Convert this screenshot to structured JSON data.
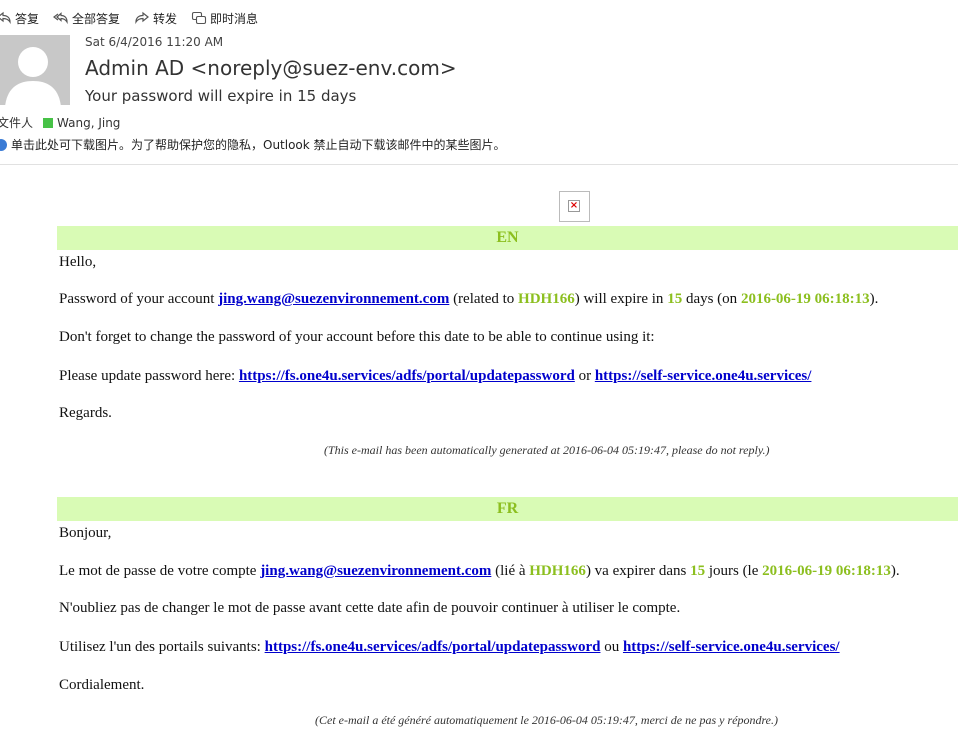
{
  "toolbar": {
    "reply": "答复",
    "reply_all": "全部答复",
    "forward": "转发",
    "im": "即时消息"
  },
  "header": {
    "date": "Sat 6/4/2016 11:20 AM",
    "from": "Admin AD <noreply@suez-env.com>",
    "subject": "Your password will expire in 15 days",
    "recipient_label": "文件人",
    "recipient_name": "Wang, Jing",
    "recipient_color": "#47c247",
    "info_bar": "单击此处可下载图片。为了帮助保护您的隐私，Outlook 禁止自动下载该邮件中的某些图片。"
  },
  "colors": {
    "lang_bar_bg": "#d9fbb5",
    "highlight": "#8cbf1f",
    "link": "#0000cc"
  },
  "en": {
    "heading": "EN",
    "greeting": "Hello,",
    "l2_a": "Password of your account ",
    "l2_link": "jing.wang@suezenvironnement.com",
    "l2_b": " (related to ",
    "l2_code": "HDH166",
    "l2_c": ") will expire in ",
    "l2_days": "15",
    "l2_d": " days (on ",
    "l2_date": "2016-06-19 06:18:13",
    "l2_e": ").",
    "l3": "Don't forget to change the password of your account before this date to be able to continue using it:",
    "l4_a": "Please update password here: ",
    "l4_link1": "https://fs.one4u.services/adfs/portal/updatepassword",
    "l4_b": " or ",
    "l4_link2": "https://self-service.one4u.services/",
    "closing": "Regards.",
    "footer": "(This e-mail has been automatically generated at 2016-06-04 05:19:47, please do not reply.)"
  },
  "fr": {
    "heading": "FR",
    "greeting": "Bonjour,",
    "l2_a": "Le mot de passe de votre compte ",
    "l2_link": "jing.wang@suezenvironnement.com",
    "l2_b": " (lié à ",
    "l2_code": "HDH166",
    "l2_c": ") va expirer dans ",
    "l2_days": "15",
    "l2_d": " jours (le ",
    "l2_date": "2016-06-19 06:18:13",
    "l2_e": ").",
    "l3": "N'oubliez pas de changer le mot de passe avant cette date afin de pouvoir continuer à utiliser le compte.",
    "l4_a": "Utilisez l'un des portails suivants: ",
    "l4_link1": "https://fs.one4u.services/adfs/portal/updatepassword",
    "l4_b": " ou ",
    "l4_link2": "https://self-service.one4u.services/",
    "closing": "Cordialement.",
    "footer": "(Cet e-mail a été généré automatiquement le 2016-06-04 05:19:47, merci de ne pas y répondre.)"
  }
}
